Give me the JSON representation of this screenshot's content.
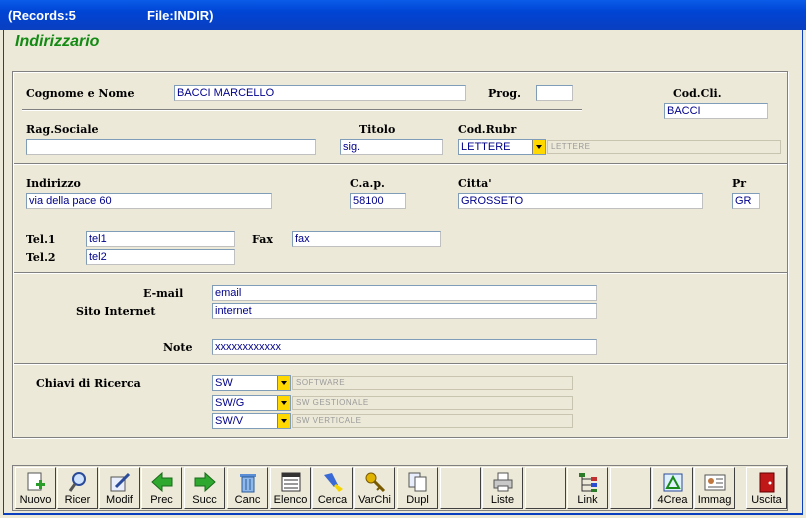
{
  "window": {
    "records": "(Records:5",
    "file": "File:INDIR)"
  },
  "app_title": "Indirizzario",
  "labels": {
    "cognome": "Cognome e Nome",
    "prog": "Prog.",
    "codcli": "Cod.Cli.",
    "ragsoc": "Rag.Sociale",
    "titolo": "Titolo",
    "codrubr": "Cod.Rubr",
    "indirizzo": "Indirizzo",
    "cap": "C.a.p.",
    "citta": "Citta'",
    "pr": "Pr",
    "tel1": "Tel.1",
    "tel2": "Tel.2",
    "fax": "Fax",
    "email": "E-mail",
    "sito": "Sito Internet",
    "note": "Note",
    "chiavi": "Chiavi di Ricerca"
  },
  "values": {
    "cognome": "BACCI MARCELLO",
    "prog": "",
    "codcli": "BACCI",
    "ragsoc": "",
    "titolo": "sig.",
    "codrubr": "LETTERE",
    "codrubr_desc": "LETTERE",
    "indirizzo": "via della pace 60",
    "cap": "58100",
    "citta": "GROSSETO",
    "pr": "GR",
    "tel1": "tel1",
    "tel2": "tel2",
    "fax": "fax",
    "email": "email",
    "sito": "internet",
    "note": "xxxxxxxxxxxx",
    "chiavi": [
      {
        "code": "SW",
        "desc": "SOFTWARE"
      },
      {
        "code": "SW/G",
        "desc": "SW GESTIONALE"
      },
      {
        "code": "SW/V",
        "desc": "SW VERTICALE"
      }
    ]
  },
  "toolbar": [
    {
      "label": "Nuovo",
      "icon": "new-document-icon"
    },
    {
      "label": "Ricer",
      "icon": "magnifier-icon"
    },
    {
      "label": "Modif",
      "icon": "edit-document-icon"
    },
    {
      "label": "Prec",
      "icon": "arrow-left-icon"
    },
    {
      "label": "Succ",
      "icon": "arrow-right-icon"
    },
    {
      "label": "Canc",
      "icon": "trash-icon"
    },
    {
      "label": "Elenco",
      "icon": "list-icon"
    },
    {
      "label": "Cerca",
      "icon": "flashlight-icon"
    },
    {
      "label": "VarChi",
      "icon": "keys-icon"
    },
    {
      "label": "Dupl",
      "icon": "duplicate-icon"
    },
    {
      "label": "",
      "icon": ""
    },
    {
      "label": "Liste",
      "icon": "printer-icon"
    },
    {
      "label": "",
      "icon": ""
    },
    {
      "label": "Link",
      "icon": "link-tree-icon"
    },
    {
      "label": "",
      "icon": ""
    },
    {
      "label": "4Crea",
      "icon": "create-icon"
    },
    {
      "label": "Immag",
      "icon": "image-card-icon"
    },
    {
      "label": "",
      "icon": ""
    },
    {
      "label": "Uscita",
      "icon": "exit-door-icon"
    }
  ]
}
